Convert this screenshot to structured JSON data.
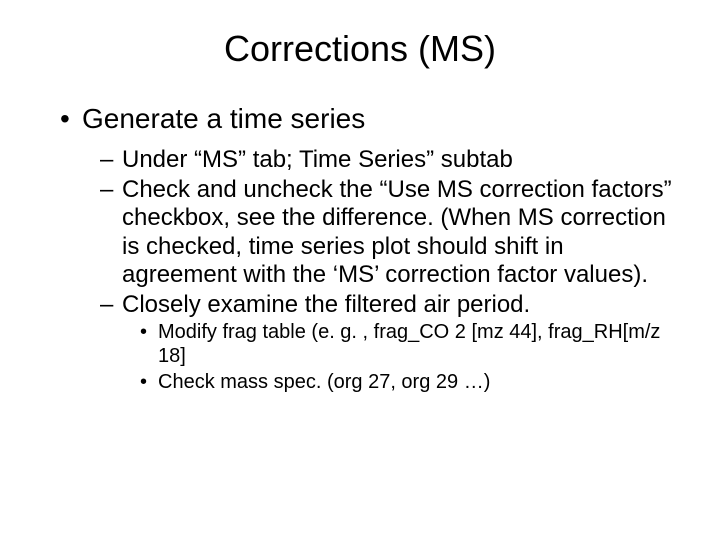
{
  "title": "Corrections (MS)",
  "bullets": {
    "l1": "Generate a time series",
    "l2a": "Under “MS” tab; Time Series” subtab",
    "l2b": "Check and uncheck the “Use MS correction factors” checkbox, see the difference. (When MS correction is checked, time series plot should shift in agreement with the ‘MS’ correction factor values).",
    "l2c": "Closely examine the filtered air period.",
    "l3a": "Modify frag table (e. g. , frag_CO 2 [mz 44], frag_RH[m/z 18]",
    "l3b": "Check mass spec. (org 27, org 29 …)"
  }
}
